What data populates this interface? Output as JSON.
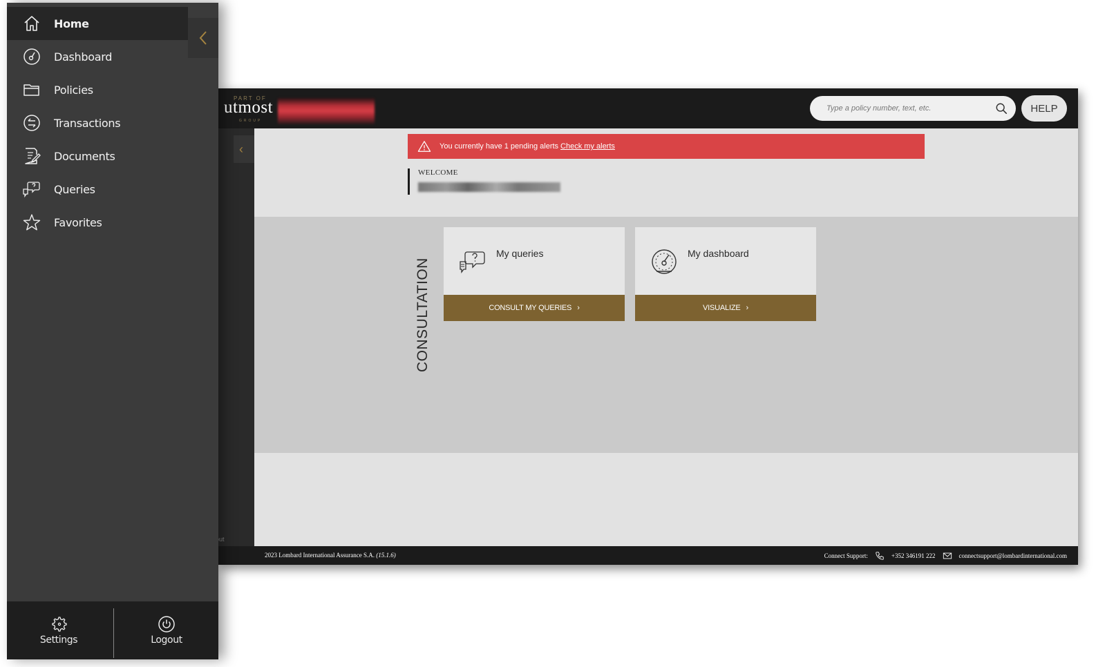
{
  "sidebar": {
    "items": [
      {
        "label": "Home",
        "icon": "home-icon",
        "active": true
      },
      {
        "label": "Dashboard",
        "icon": "speedometer-icon"
      },
      {
        "label": "Policies",
        "icon": "folder-icon"
      },
      {
        "label": "Transactions",
        "icon": "exchange-icon"
      },
      {
        "label": "Documents",
        "icon": "document-edit-icon"
      },
      {
        "label": "Queries",
        "icon": "chat-question-icon"
      },
      {
        "label": "Favorites",
        "icon": "star-icon"
      }
    ],
    "settings_label": "Settings",
    "logout_label": "Logout"
  },
  "header": {
    "brand_partof": "PART OF",
    "brand_name": "utmost",
    "brand_group": "GROUP",
    "search_placeholder": "Type a policy number, text, etc.",
    "help_label": "HELP"
  },
  "alert": {
    "text": "You currently have 1 pending alerts",
    "link": "Check my alerts"
  },
  "welcome": {
    "label": "WELCOME"
  },
  "consultation": {
    "title": "CONSULTATION",
    "cards": [
      {
        "title": "My queries",
        "button": "CONSULT MY QUERIES",
        "icon": "chat-question-icon"
      },
      {
        "title": "My dashboard",
        "button": "VISUALIZE",
        "icon": "speedometer-icon"
      }
    ]
  },
  "inner_sidebar": {
    "logout_fragment": "out"
  },
  "footer": {
    "copyright": "2023 Lombard International Assurance S.A.",
    "version": "(15.1.6)",
    "support_label": "Connect Support:",
    "phone": "+352 346191 222",
    "email": "connectsupport@lombardinternational.com"
  },
  "colors": {
    "accent_gold": "#7d6230",
    "alert_red": "#d94446",
    "sidebar_bg": "#3b3b3b",
    "header_bg": "#1b1b1b"
  }
}
